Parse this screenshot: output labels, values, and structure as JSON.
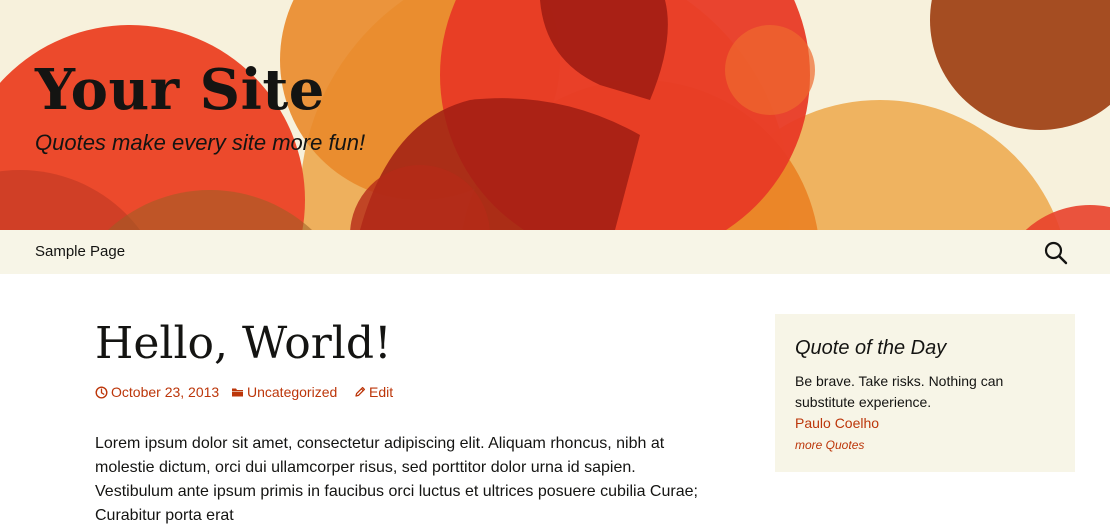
{
  "site": {
    "title": "Your Site",
    "tagline": "Quotes make every site more fun!"
  },
  "nav": {
    "items": [
      {
        "label": "Sample Page"
      }
    ],
    "search_icon": "search-icon"
  },
  "post": {
    "title": "Hello, World!",
    "date": "October 23, 2013",
    "category": "Uncategorized",
    "edit_label": "Edit",
    "content": "Lorem ipsum dolor sit amet, consectetur adipiscing elit. Aliquam rhoncus, nibh at molestie dictum, orci dui ullamcorper risus, sed porttitor dolor urna id sapien. Vestibulum ante ipsum primis in faucibus orci luctus et ultrices posuere cubilia Curae; Curabitur porta erat"
  },
  "widget": {
    "title": "Quote of the Day",
    "quote": "Be brave. Take risks. Nothing can substitute experience.",
    "author": "Paulo Coelho",
    "more_label": "more Quotes"
  },
  "colors": {
    "accent": "#bc360a",
    "nav_background": "#f7f5e7",
    "text": "#141412"
  }
}
